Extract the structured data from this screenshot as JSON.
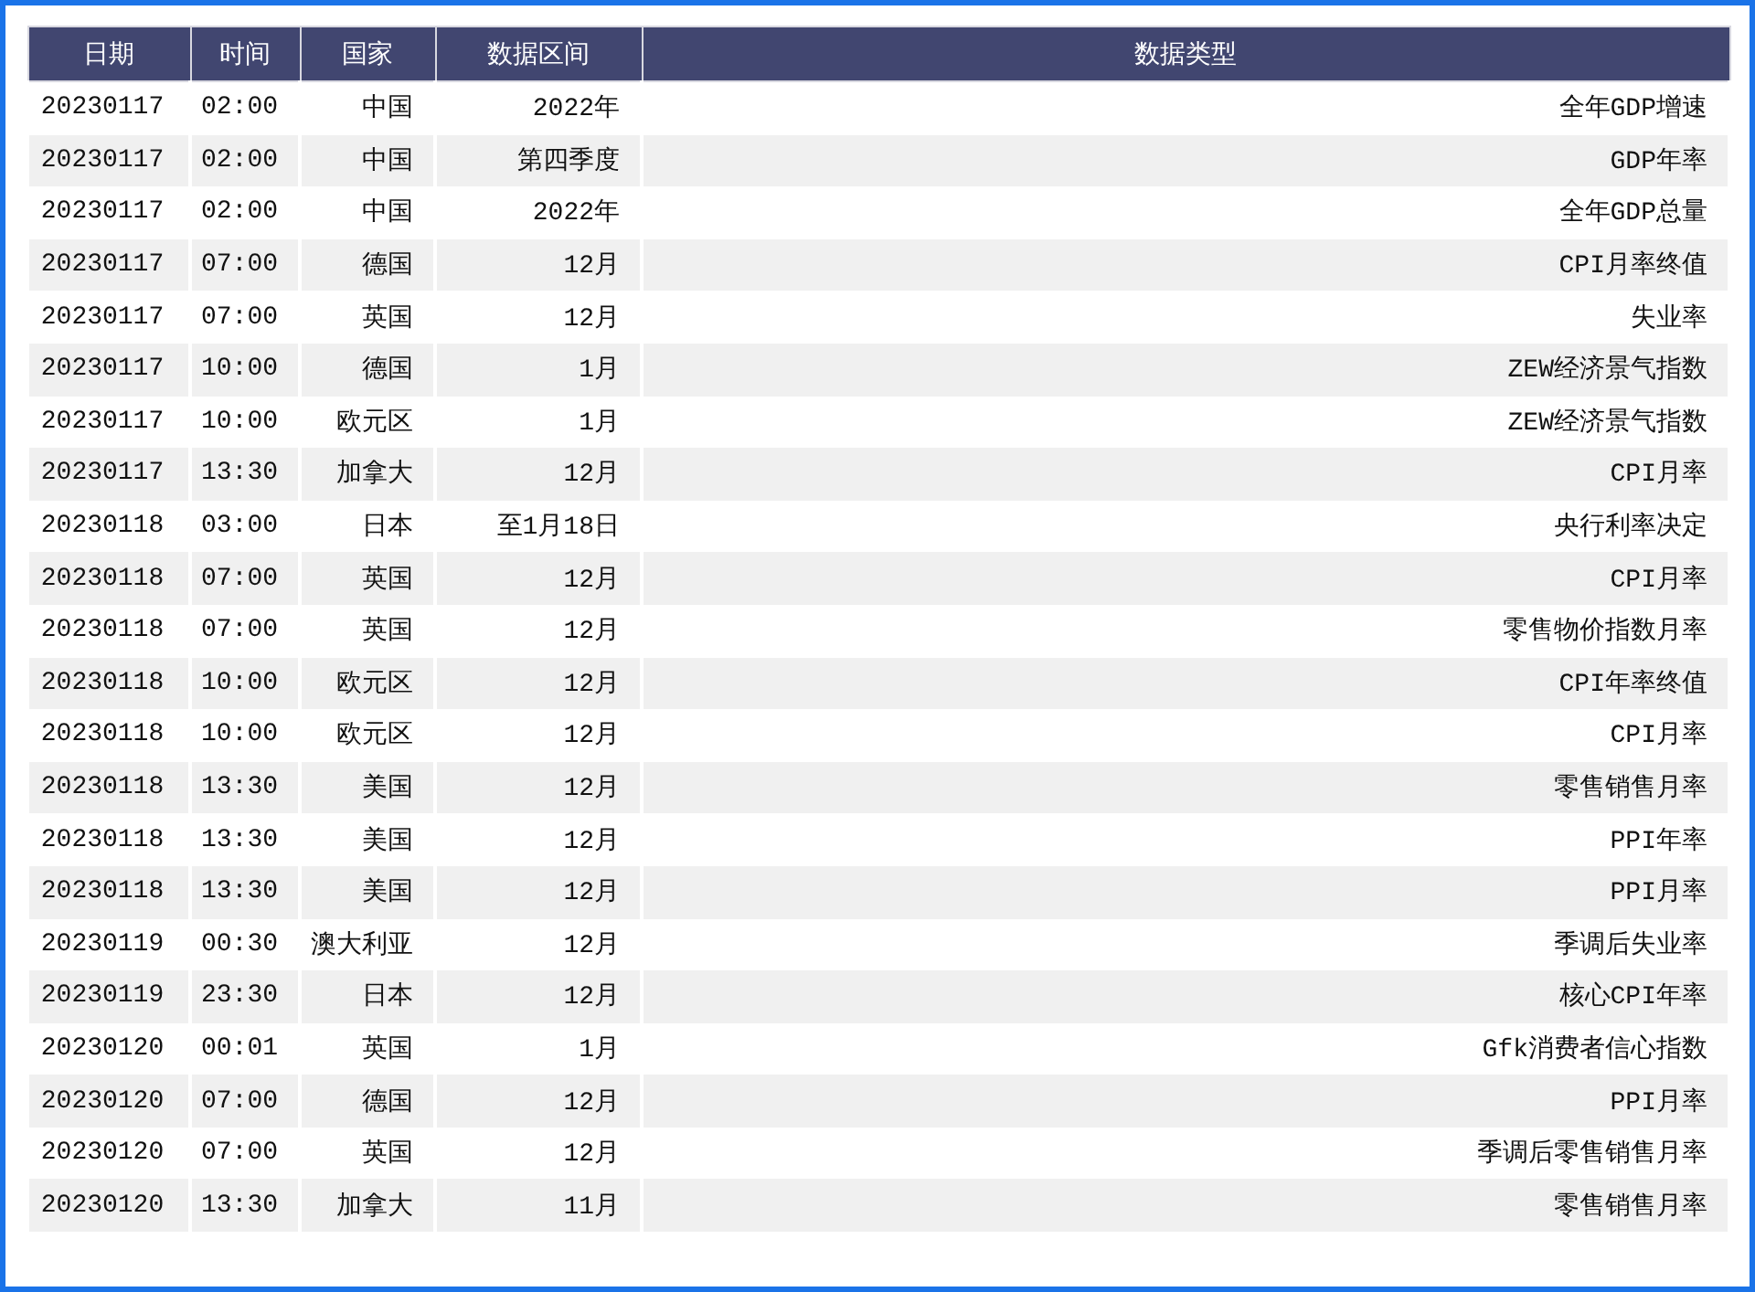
{
  "table": {
    "columns": [
      "日期",
      "时间",
      "国家",
      "数据区间",
      "数据类型"
    ],
    "rows": [
      [
        "20230117",
        "02:00",
        "中国",
        "2022年",
        "全年GDP增速"
      ],
      [
        "20230117",
        "02:00",
        "中国",
        "第四季度",
        "GDP年率"
      ],
      [
        "20230117",
        "02:00",
        "中国",
        "2022年",
        "全年GDP总量"
      ],
      [
        "20230117",
        "07:00",
        "德国",
        "12月",
        "CPI月率终值"
      ],
      [
        "20230117",
        "07:00",
        "英国",
        "12月",
        "失业率"
      ],
      [
        "20230117",
        "10:00",
        "德国",
        "1月",
        "ZEW经济景气指数"
      ],
      [
        "20230117",
        "10:00",
        "欧元区",
        "1月",
        "ZEW经济景气指数"
      ],
      [
        "20230117",
        "13:30",
        "加拿大",
        "12月",
        "CPI月率"
      ],
      [
        "20230118",
        "03:00",
        "日本",
        "至1月18日",
        "央行利率决定"
      ],
      [
        "20230118",
        "07:00",
        "英国",
        "12月",
        "CPI月率"
      ],
      [
        "20230118",
        "07:00",
        "英国",
        "12月",
        "零售物价指数月率"
      ],
      [
        "20230118",
        "10:00",
        "欧元区",
        "12月",
        "CPI年率终值"
      ],
      [
        "20230118",
        "10:00",
        "欧元区",
        "12月",
        "CPI月率"
      ],
      [
        "20230118",
        "13:30",
        "美国",
        "12月",
        "零售销售月率"
      ],
      [
        "20230118",
        "13:30",
        "美国",
        "12月",
        "PPI年率"
      ],
      [
        "20230118",
        "13:30",
        "美国",
        "12月",
        "PPI月率"
      ],
      [
        "20230119",
        "00:30",
        "澳大利亚",
        "12月",
        "季调后失业率"
      ],
      [
        "20230119",
        "23:30",
        "日本",
        "12月",
        "核心CPI年率"
      ],
      [
        "20230120",
        "00:01",
        "英国",
        "1月",
        "Gfk消费者信心指数"
      ],
      [
        "20230120",
        "07:00",
        "德国",
        "12月",
        "PPI月率"
      ],
      [
        "20230120",
        "07:00",
        "英国",
        "12月",
        "季调后零售销售月率"
      ],
      [
        "20230120",
        "13:30",
        "加拿大",
        "11月",
        "零售销售月率"
      ]
    ]
  }
}
